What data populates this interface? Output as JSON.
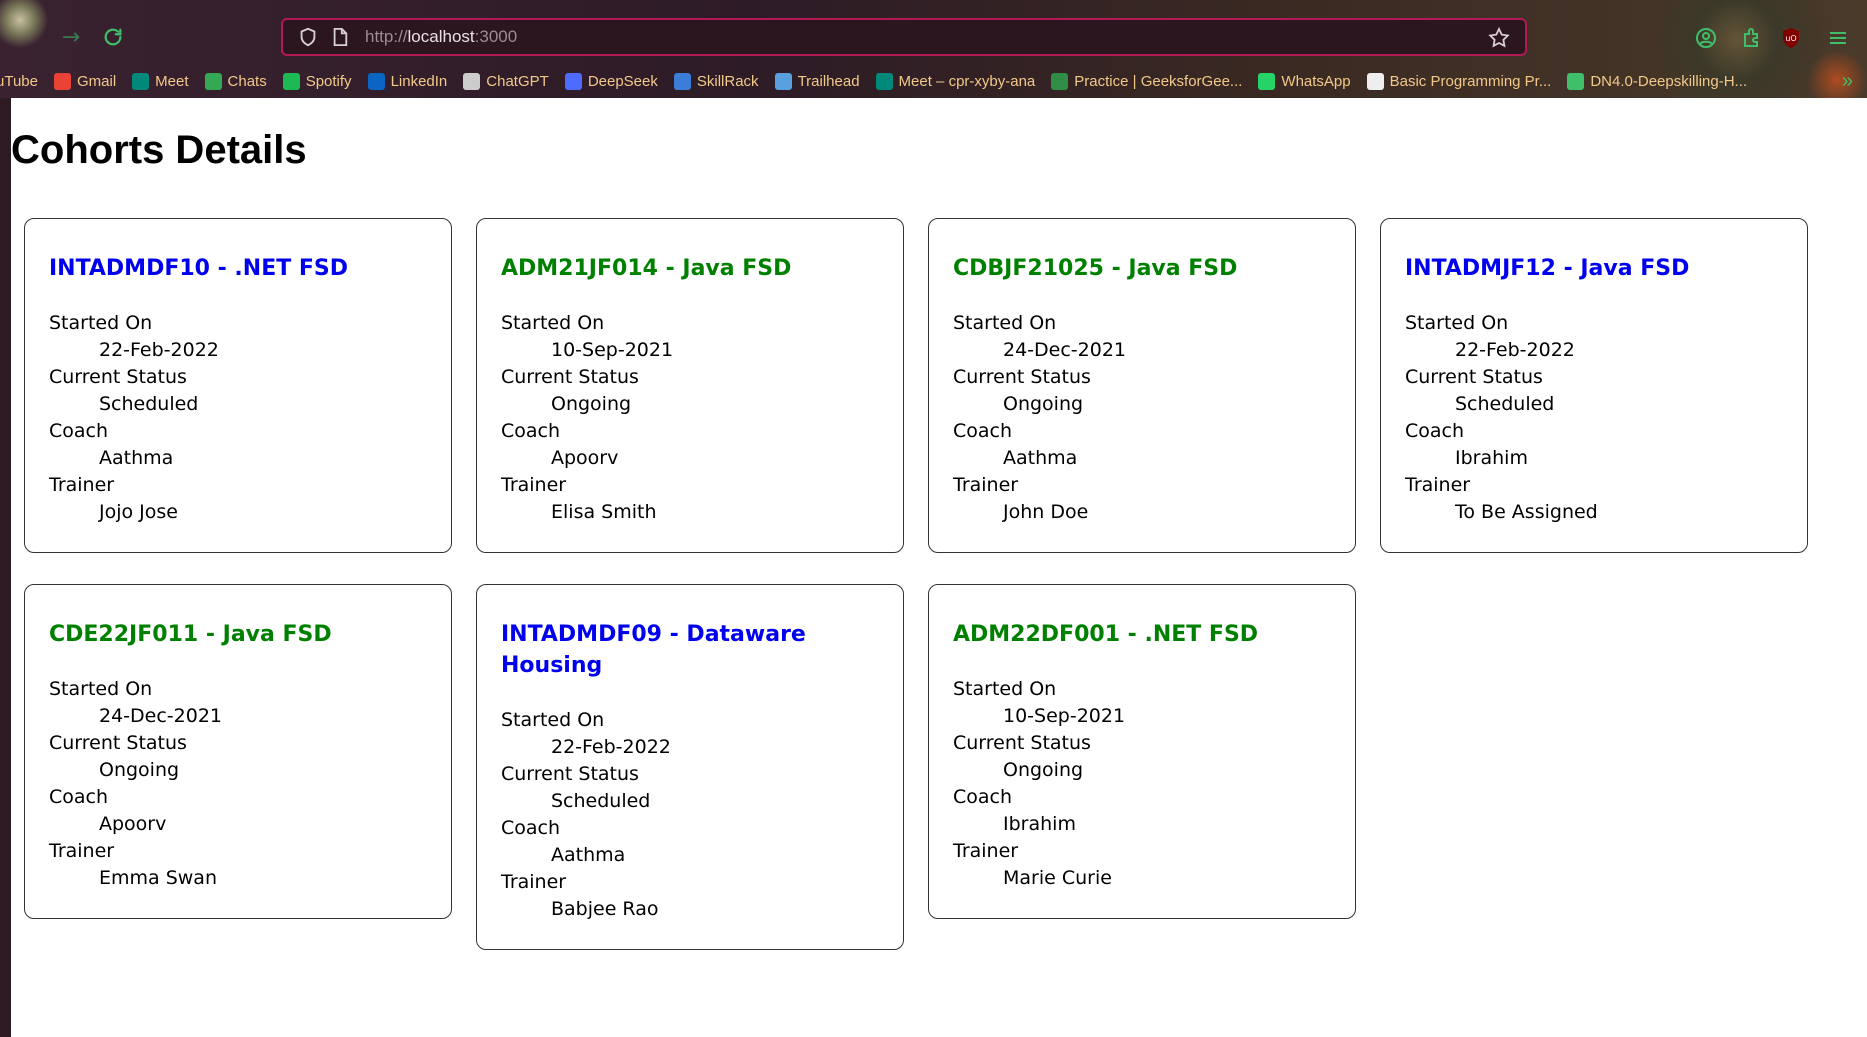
{
  "browser": {
    "url_scheme": "http://",
    "url_host": "localhost",
    "url_port": ":3000",
    "bookmarks": [
      {
        "label": "uTube",
        "icon": "youtube-icon",
        "color": "#ff0000"
      },
      {
        "label": "Gmail",
        "icon": "gmail-icon",
        "color": "#ea4335"
      },
      {
        "label": "Meet",
        "icon": "meet-icon",
        "color": "#00897b"
      },
      {
        "label": "Chats",
        "icon": "chat-icon",
        "color": "#34a853"
      },
      {
        "label": "Spotify",
        "icon": "spotify-icon",
        "color": "#1db954"
      },
      {
        "label": "LinkedIn",
        "icon": "linkedin-icon",
        "color": "#0a66c2"
      },
      {
        "label": "ChatGPT",
        "icon": "chatgpt-icon",
        "color": "#cccccc"
      },
      {
        "label": "DeepSeek",
        "icon": "deepseek-icon",
        "color": "#4d6bfe"
      },
      {
        "label": "SkillRack",
        "icon": "skillrack-icon",
        "color": "#3b7dd8"
      },
      {
        "label": "Trailhead",
        "icon": "trailhead-icon",
        "color": "#5aa0e0"
      },
      {
        "label": "Meet – cpr-xyby-ana",
        "icon": "meet-icon",
        "color": "#00897b"
      },
      {
        "label": "Practice | GeeksforGee...",
        "icon": "gfg-icon",
        "color": "#2f8d46"
      },
      {
        "label": "WhatsApp",
        "icon": "whatsapp-icon",
        "color": "#25d366"
      },
      {
        "label": "Basic Programming Pr...",
        "icon": "hackerearth-icon",
        "color": "#eeeeee"
      },
      {
        "label": "DN4.0-Deepskilling-H...",
        "icon": "globe-icon",
        "color": "#3fbf6a"
      }
    ]
  },
  "page": {
    "title": "Cohorts Details",
    "labels": {
      "started_on": "Started On",
      "current_status": "Current Status",
      "coach": "Coach",
      "trainer": "Trainer"
    }
  },
  "colors": {
    "scheduled_heading": "#0000ee",
    "ongoing_heading": "#008000"
  },
  "cohorts": [
    {
      "title": "INTADMDF10 - .NET FSD",
      "started_on": "22-Feb-2022",
      "status": "Scheduled",
      "coach": "Aathma",
      "trainer": "Jojo Jose"
    },
    {
      "title": "ADM21JF014 - Java FSD",
      "started_on": "10-Sep-2021",
      "status": "Ongoing",
      "coach": "Apoorv",
      "trainer": "Elisa Smith"
    },
    {
      "title": "CDBJF21025 - Java FSD",
      "started_on": "24-Dec-2021",
      "status": "Ongoing",
      "coach": "Aathma",
      "trainer": "John Doe"
    },
    {
      "title": "INTADMJF12 - Java FSD",
      "started_on": "22-Feb-2022",
      "status": "Scheduled",
      "coach": "Ibrahim",
      "trainer": "To Be Assigned"
    },
    {
      "title": "CDE22JF011 - Java FSD",
      "started_on": "24-Dec-2021",
      "status": "Ongoing",
      "coach": "Apoorv",
      "trainer": "Emma Swan"
    },
    {
      "title": "INTADMDF09 - Dataware Housing",
      "started_on": "22-Feb-2022",
      "status": "Scheduled",
      "coach": "Aathma",
      "trainer": "Babjee Rao"
    },
    {
      "title": "ADM22DF001 - .NET FSD",
      "started_on": "10-Sep-2021",
      "status": "Ongoing",
      "coach": "Ibrahim",
      "trainer": "Marie Curie"
    }
  ]
}
